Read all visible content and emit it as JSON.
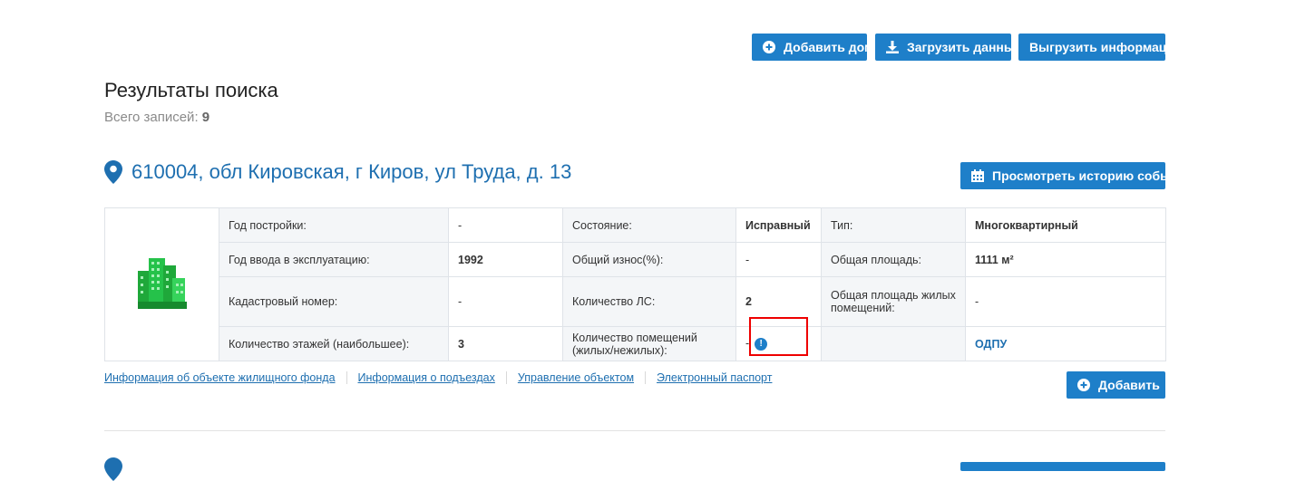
{
  "toolbar": {
    "add_house": "Добавить дом",
    "upload_data": "Загрузить данные",
    "export_info": "Выгрузить информацию"
  },
  "results": {
    "title": "Результаты поиска",
    "count_label": "Всего записей:",
    "count_value": "9"
  },
  "record": {
    "address": "610004, обл Кировская, г Киров, ул Труда, д. 13",
    "history_button": "Просмотреть историю событий",
    "rows": [
      {
        "l1": "Год постройки:",
        "v1": "-",
        "l2": "Состояние:",
        "v2": "Исправный",
        "l3": "Тип:",
        "v3": "Многоквартирный"
      },
      {
        "l1": "Год ввода в эксплуатацию:",
        "v1": "1992",
        "l2": "Общий износ(%):",
        "v2": "-",
        "l3": "Общая площадь:",
        "v3": "1111 м²"
      },
      {
        "l1": "Кадастровый номер:",
        "v1": "-",
        "l2": "Количество ЛС:",
        "v2": "2",
        "l3": "Общая площадь жилых помещений:",
        "v3": "-"
      },
      {
        "l1": "Количество этажей (наибольшее):",
        "v1": "3",
        "l2": "Количество помещений (жилых/нежилых):",
        "v2": "-",
        "l3": "",
        "v3": "ОДПУ"
      }
    ],
    "links": [
      "Информация об объекте жилищного фонда",
      "Информация о подъездах",
      "Управление объектом",
      "Электронный паспорт"
    ],
    "add_button": "Добавить"
  },
  "colors": {
    "accent": "#1e7fc9",
    "link": "#1e6fb0",
    "highlight": "#e00000"
  }
}
